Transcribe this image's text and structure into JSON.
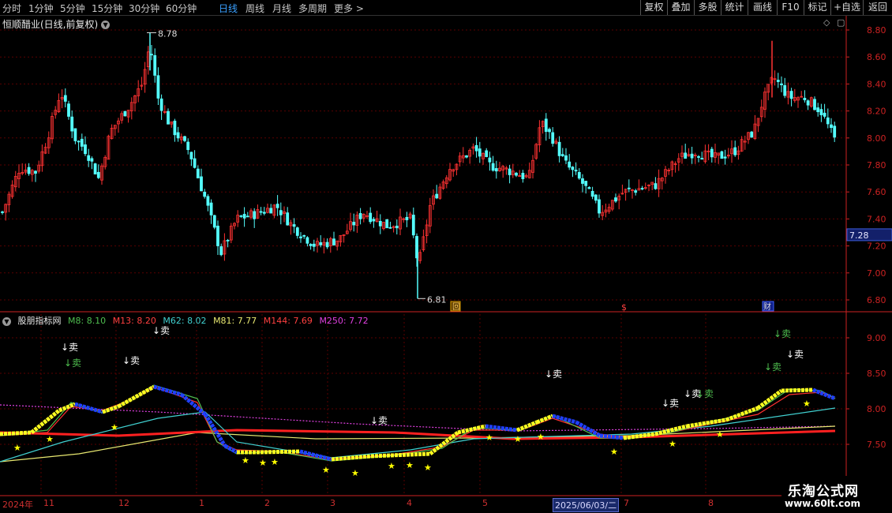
{
  "toolbar": {
    "tabs": [
      "分时",
      "1分钟",
      "5分钟",
      "15分钟",
      "30分钟",
      "60分钟",
      "日线",
      "周线",
      "月线",
      "多周期",
      "更多"
    ],
    "active": "日线",
    "more_arrow": ">",
    "right_buttons": [
      "复权",
      "叠加",
      "多股",
      "统计",
      "画线",
      "F10",
      "标记",
      "+自选",
      "返回"
    ]
  },
  "stock": {
    "title": "恒顺醋业(日线,前复权)"
  },
  "price_axis": {
    "labels": [
      "8.80",
      "8.60",
      "8.40",
      "8.20",
      "8.00",
      "7.80",
      "7.60",
      "7.40",
      "7.20",
      "7.00",
      "6.80"
    ],
    "current_price": "7.28"
  },
  "annotations": {
    "high": "8.78",
    "low": "6.81",
    "marker_hui": "回",
    "marker_s": "$",
    "marker_cai": "财"
  },
  "indicator": {
    "name": "股朋指标网",
    "legend": [
      {
        "text": "M8: 8.10",
        "color": "#4fbf4f"
      },
      {
        "text": "M13: 8.20",
        "color": "#ff4040"
      },
      {
        "text": "M62: 8.02",
        "color": "#40d0d0"
      },
      {
        "text": "M81: 7.77",
        "color": "#e8e870"
      },
      {
        "text": "M144: 7.69",
        "color": "#ff4040"
      },
      {
        "text": "M250: 7.72",
        "color": "#e040e0"
      }
    ],
    "axis": [
      "9.00",
      "8.50",
      "8.00",
      "7.50"
    ],
    "sell_label": "卖"
  },
  "dates": {
    "labels": [
      "2024年",
      "11",
      "12",
      "1",
      "2",
      "3",
      "4",
      "5",
      "2025/06/03/二",
      "7",
      "8"
    ]
  },
  "watermark": {
    "line1": "乐淘公式网",
    "line2": "www.60lt.com"
  },
  "colors": {
    "up": "#ff3232",
    "down": "#54ffff",
    "grid": "#5a0000",
    "axis": "#cc2222"
  }
}
